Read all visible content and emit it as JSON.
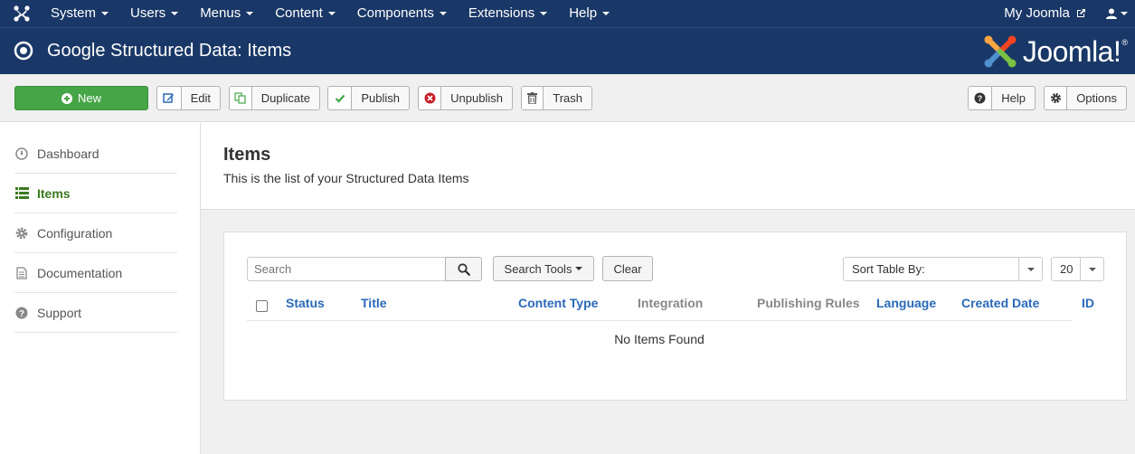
{
  "navbar": {
    "logo_icon": "joomla-icon",
    "menu": [
      {
        "label": "System"
      },
      {
        "label": "Users"
      },
      {
        "label": "Menus"
      },
      {
        "label": "Content"
      },
      {
        "label": "Components"
      },
      {
        "label": "Extensions"
      },
      {
        "label": "Help"
      }
    ],
    "site_link": "My Joomla",
    "site_link_icon": "external-link-icon",
    "user_icon": "user-icon"
  },
  "header": {
    "icon": "target-circle-icon",
    "title": "Google Structured Data: Items",
    "brand": "Joomla!"
  },
  "toolbar": {
    "new_label": "New",
    "edit_label": "Edit",
    "duplicate_label": "Duplicate",
    "publish_label": "Publish",
    "unpublish_label": "Unpublish",
    "trash_label": "Trash",
    "help_label": "Help",
    "options_label": "Options"
  },
  "sidebar": {
    "items": [
      {
        "label": "Dashboard",
        "icon": "dashboard-icon",
        "active": false
      },
      {
        "label": "Items",
        "icon": "list-icon",
        "active": true
      },
      {
        "label": "Configuration",
        "icon": "gear-icon",
        "active": false
      },
      {
        "label": "Documentation",
        "icon": "document-icon",
        "active": false
      },
      {
        "label": "Support",
        "icon": "question-icon",
        "active": false
      }
    ]
  },
  "content": {
    "title": "Items",
    "description": "This is the list of your Structured Data Items"
  },
  "filters": {
    "search_placeholder": "Search",
    "search_tools_label": "Search Tools",
    "clear_label": "Clear",
    "sort_label": "Sort Table By:",
    "limit_value": "20"
  },
  "table": {
    "columns": [
      {
        "label": "Status",
        "sortable": true
      },
      {
        "label": "Title",
        "sortable": true
      },
      {
        "label": "Content Type",
        "sortable": true
      },
      {
        "label": "Integration",
        "sortable": false
      },
      {
        "label": "Publishing Rules",
        "sortable": false
      },
      {
        "label": "Language",
        "sortable": true
      },
      {
        "label": "Created Date",
        "sortable": true
      },
      {
        "label": "ID",
        "sortable": true
      }
    ],
    "empty_message": "No Items Found"
  },
  "colors": {
    "navbar": "#1a3867",
    "new_button": "#46a546",
    "link": "#2a69b8",
    "active_sidebar": "#3a7a20"
  }
}
